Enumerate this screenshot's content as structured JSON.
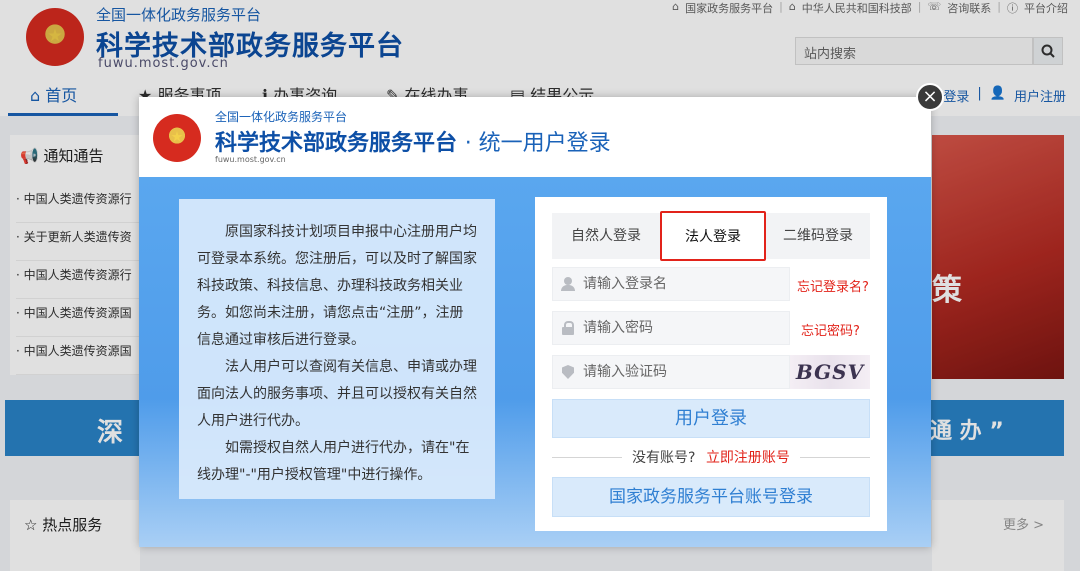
{
  "site": {
    "subtitle": "全国一体化政务服务平台",
    "title": "科学技术部政务服务平台",
    "domain": "fuwu.most.gov.cn",
    "toplinks": [
      "国家政务服务平台",
      "中华人民共和国科技部",
      "咨询联系",
      "平台介绍"
    ],
    "search_placeholder": "站内搜索",
    "nav": [
      "首页",
      "服务事项",
      "办事咨询",
      "在线办事",
      "结果公示"
    ],
    "nav_right": [
      "登录",
      "用户注册"
    ],
    "notice_title": "通知通告",
    "notices": [
      "中国人类遗传资源行",
      "关于更新人类遗传资",
      "中国人类遗传资源行",
      "中国人类遗传资源国",
      "中国人类遗传资源国"
    ],
    "band_left_text": "深",
    "banner_text": "策",
    "band_right_text": "通 办 ”",
    "hot_title": "热点服务",
    "more_label": "更多 >"
  },
  "modal": {
    "subtitle": "全国一体化政务服务平台",
    "title": "科学技术部政务服务平台",
    "title_suffix": "· 统一用户登录",
    "domain": "fuwu.most.gov.cn",
    "close_glyph": "×",
    "info_paragraphs": [
      "原国家科技计划项目申报中心注册用户均可登录本系统。您注册后，可以及时了解国家科技政策、科技信息、办理科技政务相关业务。如您尚未注册，请您点击“注册”，注册信息通过审核后进行登录。",
      "法人用户可以查阅有关信息、申请或办理面向法人的服务事项、并且可以授权有关自然人用户进行代办。",
      "如需授权自然人用户进行代办，请在\"在线办理\"-\"用户授权管理\"中进行操作。"
    ],
    "tabs": [
      "自然人登录",
      "法人登录",
      "二维码登录"
    ],
    "active_tab": "法人登录",
    "username_placeholder": "请输入登录名",
    "password_placeholder": "请输入密码",
    "captcha_placeholder": "请输入验证码",
    "forgot_username": "忘记登录名?",
    "forgot_password": "忘记密码?",
    "captcha_text": "BGSV",
    "login_button": "用户登录",
    "no_account": "没有账号?",
    "register_link": "立即注册账号",
    "gov_login_button": "国家政务服务平台账号登录",
    "accent_color": "#e2231a",
    "brand_color": "#0d4fa6"
  }
}
